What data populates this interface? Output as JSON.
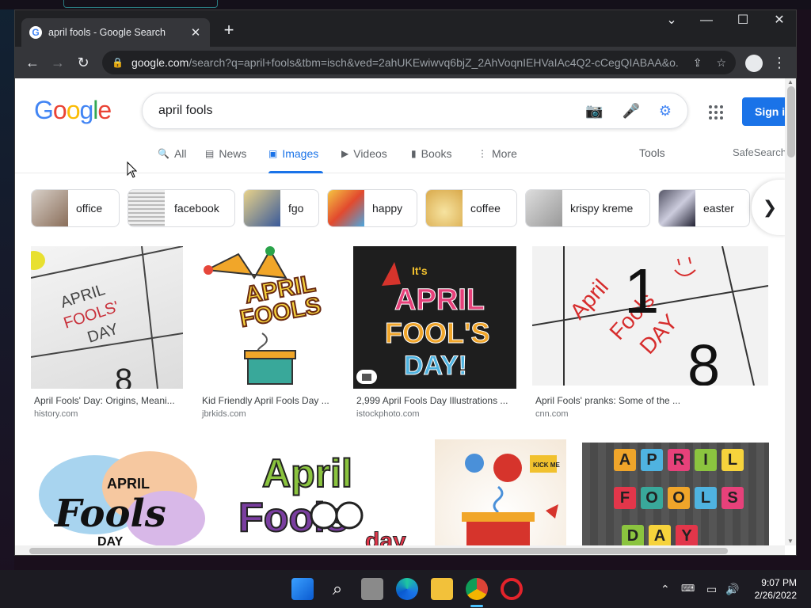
{
  "browser": {
    "tab_title": "april fools - Google Search",
    "url_domain": "google.com",
    "url_path": "/search?q=april+fools&tbm=isch&ved=2ahUKEwiwvq6bjZ_2AhVoqnIEHVaIAc4Q2-cCegQIABAA&o..."
  },
  "search": {
    "logo": "Google",
    "query": "april fools",
    "sign_in": "Sign i"
  },
  "nav": {
    "all": "All",
    "news": "News",
    "images": "Images",
    "videos": "Videos",
    "books": "Books",
    "more": "More",
    "tools": "Tools",
    "safesearch": "SafeSearch"
  },
  "chips": [
    "office",
    "facebook",
    "fgo",
    "happy",
    "coffee",
    "krispy kreme",
    "easter"
  ],
  "results": [
    {
      "caption": "April Fools' Day: Origins, Meani...",
      "source": "history.com"
    },
    {
      "caption": "Kid Friendly April Fools Day ...",
      "source": "jbrkids.com"
    },
    {
      "caption": "2,999 April Fools Day Illustrations ...",
      "source": "istockphoto.com"
    },
    {
      "caption": "April Fools' pranks: Some of the ...",
      "source": "cnn.com"
    }
  ],
  "image_text": {
    "r1": [
      "APRIL",
      "FOOLS'",
      "DAY"
    ],
    "r2": [
      "APRIL",
      "FOOLS"
    ],
    "r3": [
      "It's",
      "APRIL",
      "FOOL'S",
      "DAY!"
    ],
    "r4": [
      "April",
      "Fools",
      "DAY"
    ],
    "r5": [
      "APRIL",
      "Fools",
      "DAY"
    ],
    "r6": [
      "April",
      "Fools",
      "day"
    ],
    "r7": [
      "KICK ME"
    ],
    "r8_blocks": [
      "A",
      "P",
      "R",
      "I",
      "L",
      "F",
      "O",
      "O",
      "L",
      "S",
      "D",
      "A",
      "Y"
    ]
  },
  "taskbar": {
    "time": "9:07 PM",
    "date": "2/26/2022"
  }
}
